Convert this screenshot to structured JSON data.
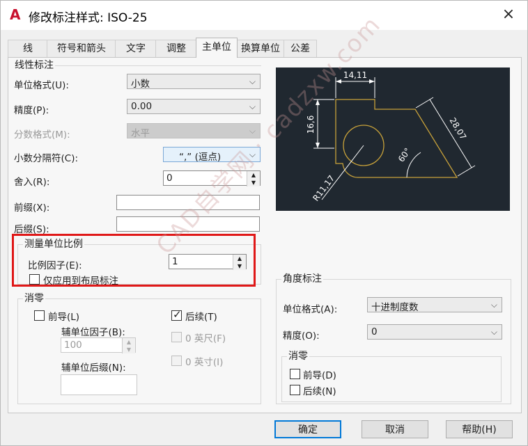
{
  "window": {
    "title": "修改标注样式: ISO-25",
    "close_glyph": "×"
  },
  "tabs": [
    {
      "label": "线"
    },
    {
      "label": "符号和箭头"
    },
    {
      "label": "文字"
    },
    {
      "label": "调整"
    },
    {
      "label": "主单位"
    },
    {
      "label": "换算单位"
    },
    {
      "label": "公差"
    }
  ],
  "linear": {
    "title": "线性标注",
    "unit_format_label": "单位格式(U):",
    "unit_format_value": "小数",
    "precision_label": "精度(P):",
    "precision_value": "0.00",
    "fraction_label": "分数格式(M):",
    "fraction_value": "水平",
    "decimal_sep_label": "小数分隔符(C):",
    "decimal_sep_value": "“,” (逗点)",
    "round_label": "舍入(R):",
    "round_value": "0",
    "prefix_label": "前缀(X):",
    "prefix_value": "",
    "suffix_label": "后缀(S):",
    "suffix_value": ""
  },
  "scale": {
    "title": "测量单位比例",
    "factor_label": "比例因子(E):",
    "factor_value": "1",
    "layout_only_label": "仅应用到布局标注"
  },
  "zero_suppress": {
    "title": "消零",
    "leading_label": "前导(L)",
    "trailing_label": "后续(T)",
    "sub_factor_label": "辅单位因子(B):",
    "sub_factor_value": "100",
    "sub_suffix_label": "辅单位后缀(N):",
    "sub_suffix_value": "",
    "feet_label": "0 英尺(F)",
    "inches_label": "0 英寸(I)"
  },
  "preview": {
    "dim_top": "14,11",
    "dim_left": "16,6",
    "dim_right": "28,07",
    "angle": "60°",
    "radius": "R11,17"
  },
  "angular": {
    "title": "角度标注",
    "unit_format_label": "单位格式(A):",
    "unit_format_value": "十进制度数",
    "precision_label": "精度(O):",
    "precision_value": "0",
    "zero_title": "消零",
    "leading_label": "前导(D)",
    "trailing_label": "后续(N)"
  },
  "buttons": {
    "ok": "确定",
    "cancel": "取消",
    "help": "帮助(H)"
  },
  "watermark": "CAD自学网 · cadzxw.com",
  "colors": {
    "preview_bg": "#202830",
    "geometry": "#c8a23a",
    "dims": "#ffffff",
    "highlight": "#e01818"
  }
}
